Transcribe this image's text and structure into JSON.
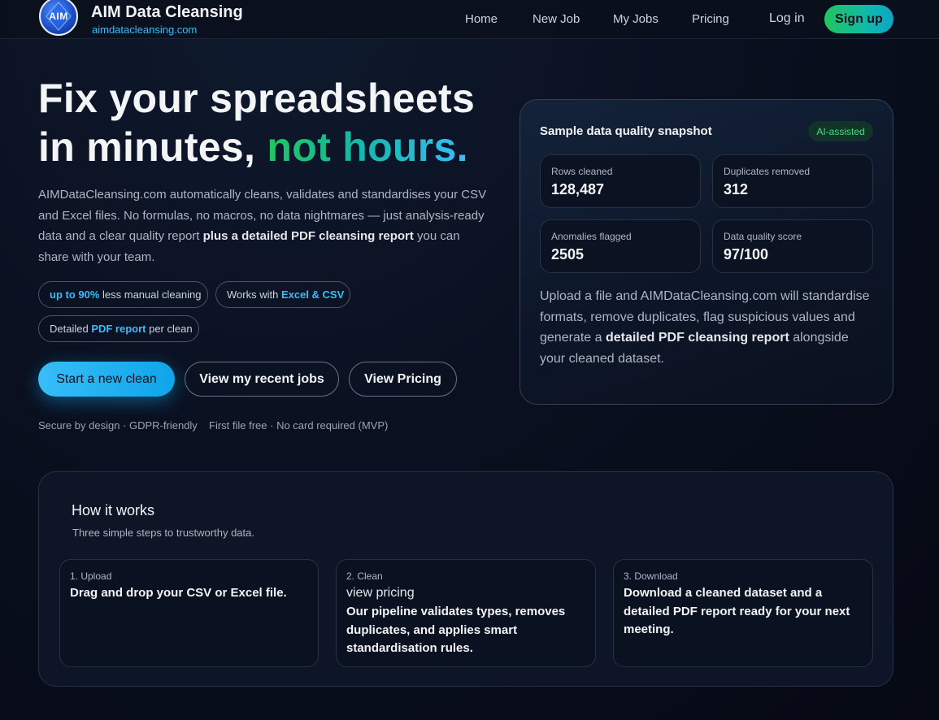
{
  "brand": {
    "logo_text": "AIM",
    "title": "AIM Data Cleansing",
    "url": "aimdatacleansing.com"
  },
  "nav": {
    "home": "Home",
    "new_job": "New Job",
    "my_jobs": "My Jobs",
    "pricing": "Pricing",
    "login": "Log in",
    "signup": "Sign up"
  },
  "hero": {
    "line1": "Fix your spreadsheets",
    "line2_start": "in minutes, ",
    "line2_accent": "not hours.",
    "desc_part1": "AIMDataCleansing.com automatically cleans, validates and standardises your CSV and Excel files. No formulas, no macros, no data nightmares — just analysis-ready data and a clear quality report ",
    "desc_bold": "plus a detailed PDF cleansing report",
    "desc_part2": " you can share with your team.",
    "pills": {
      "p1_bold": "up to 90%",
      "p1_text": " less manual cleaning",
      "p2_text": "Works with ",
      "p2_bold": "Excel & CSV",
      "p3_text": "Detailed ",
      "p3_bold": "PDF report",
      "p3_text2": " per clean"
    },
    "buttons": {
      "start": "Start a new clean",
      "recent": "View my recent jobs",
      "pricing": "View Pricing"
    },
    "fine_1": "Secure by design · GDPR-friendly",
    "fine_2": "First file free · No card required (MVP)"
  },
  "snapshot": {
    "title": "Sample data quality snapshot",
    "badge": "AI-assisted",
    "stats": [
      {
        "label": "Rows cleaned",
        "value": "128,487"
      },
      {
        "label": "Duplicates removed",
        "value": "312"
      },
      {
        "label": "Anomalies flagged",
        "value": "2505"
      },
      {
        "label": "Data quality score",
        "value": "97/100"
      }
    ],
    "desc_part1": "Upload a file and AIMDataCleansing.com will standardise formats, remove duplicates, flag suspicious values and generate a ",
    "desc_bold": "detailed PDF cleansing report",
    "desc_part2": " alongside your cleaned dataset."
  },
  "how": {
    "title": "How it works",
    "subtitle": "Three simple steps to trustworthy data.",
    "steps": [
      {
        "label": "1. Upload",
        "text": "Drag and drop your CSV or Excel file."
      },
      {
        "label": "2. Clean",
        "extra": "view pricing",
        "text": "Our pipeline validates types, removes duplicates, and applies smart standardisation rules."
      },
      {
        "label": "3. Download",
        "text_part1": "Download a cleaned dataset and a ",
        "text_bold": "detailed PDF report",
        "text_part2": " ready for your next meeting."
      }
    ]
  }
}
